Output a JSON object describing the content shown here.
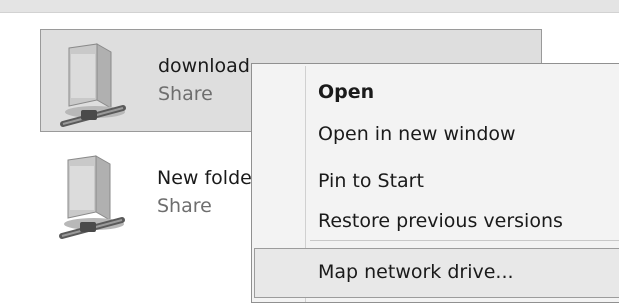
{
  "items": [
    {
      "name": "download",
      "subtitle": "Share",
      "icon": "shared-folder-icon",
      "selected": true
    },
    {
      "name": "New folder",
      "subtitle": "Share",
      "icon": "shared-folder-icon",
      "selected": false
    }
  ],
  "context_menu": {
    "open": "Open",
    "open_new_window": "Open in new window",
    "pin_to_start": "Pin to Start",
    "restore_previous": "Restore previous versions",
    "map_network_drive": "Map network drive..."
  },
  "colors": {
    "selection_bg": "#dedede",
    "menu_bg": "#f3f3f3"
  }
}
